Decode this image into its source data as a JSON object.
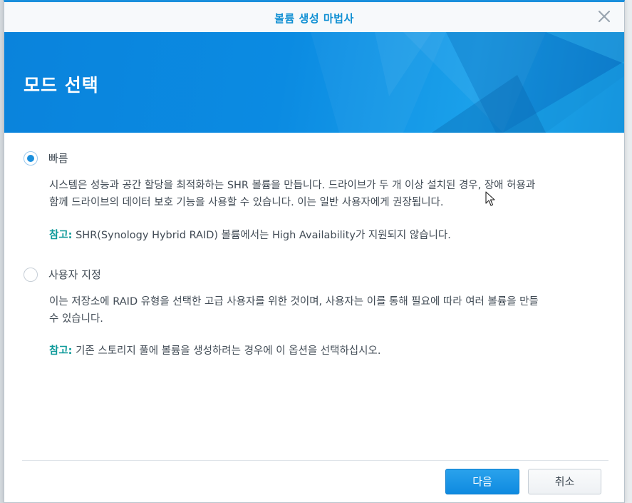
{
  "window": {
    "title": "볼륨 생성 마법사",
    "accent_color": "#1a8fdc",
    "close_icon": "close-icon"
  },
  "banner": {
    "title": "모드 선택"
  },
  "options": [
    {
      "label": "빠름",
      "selected": true,
      "description_lines": [
        "시스템은 성능과 공간 할당을 최적화하는 SHR 볼륨을 만듭니다. 드라이브가 두 개 이상 설치된 경우, 장애 허용과",
        "함께 드라이브의 데이터 보호 기능을 사용할 수 있습니다. 이는 일반 사용자에게 권장됩니다."
      ],
      "note_prefix": "참고:",
      "note_text": " SHR(Synology Hybrid RAID) 볼륨에서는 High Availability가 지원되지 않습니다."
    },
    {
      "label": "사용자 지정",
      "selected": false,
      "description_lines": [
        "이는 저장소에 RAID 유형을 선택한 고급 사용자를 위한 것이며, 사용자는 이를 통해 필요에 따라 여러 볼륨을 만들",
        "수 있습니다."
      ],
      "note_prefix": "참고:",
      "note_text": " 기존 스토리지 풀에 볼륨을 생성하려는 경우에 이 옵션을 선택하십시오."
    }
  ],
  "footer": {
    "next_label": "다음",
    "cancel_label": "취소"
  }
}
